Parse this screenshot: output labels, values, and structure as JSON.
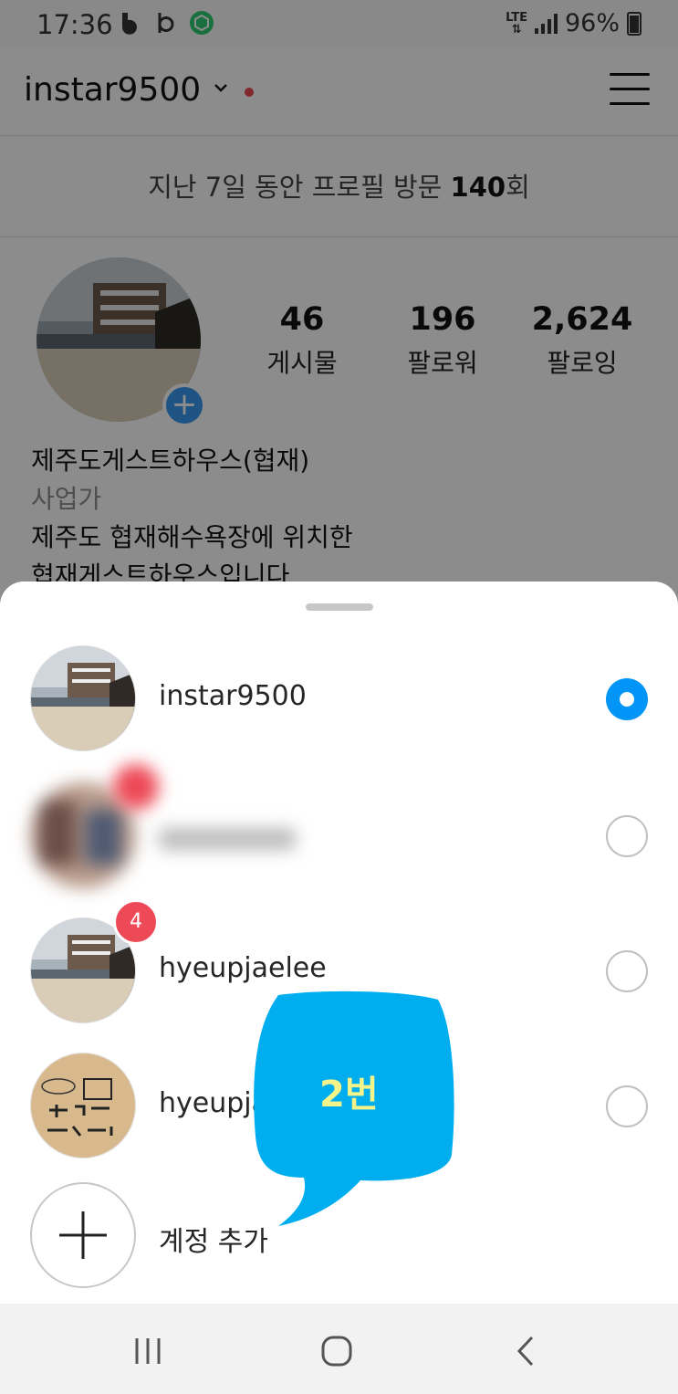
{
  "status_bar": {
    "time": "17:36",
    "network": "LTE",
    "battery": "96%"
  },
  "header": {
    "username": "instar9500"
  },
  "insights": {
    "prefix": "지난 7일 동안 프로필 방문 ",
    "count": "140",
    "suffix": "회"
  },
  "profile": {
    "stats": [
      {
        "value": "46",
        "label": "게시물"
      },
      {
        "value": "196",
        "label": "팔로워"
      },
      {
        "value": "2,624",
        "label": "팔로잉"
      }
    ],
    "name": "제주도게스트하우스(협재)",
    "category": "사업가",
    "bio_line1": "제주도 협재해수욕장에 위치한",
    "bio_line2": "협재게스트하우스입니다"
  },
  "account_switcher": {
    "accounts": [
      {
        "username": "instar9500",
        "selected": true,
        "badge": ""
      },
      {
        "username": "",
        "selected": false,
        "badge": ""
      },
      {
        "username": "hyeupjaelee",
        "selected": false,
        "badge": "4"
      },
      {
        "username": "hyeupja",
        "selected": false,
        "badge": ""
      }
    ],
    "add_account_label": "계정 추가"
  },
  "annotation": {
    "text": "2번",
    "color": "#00aeef"
  },
  "colors": {
    "accent": "#0095f6",
    "badge": "#ed4956"
  }
}
